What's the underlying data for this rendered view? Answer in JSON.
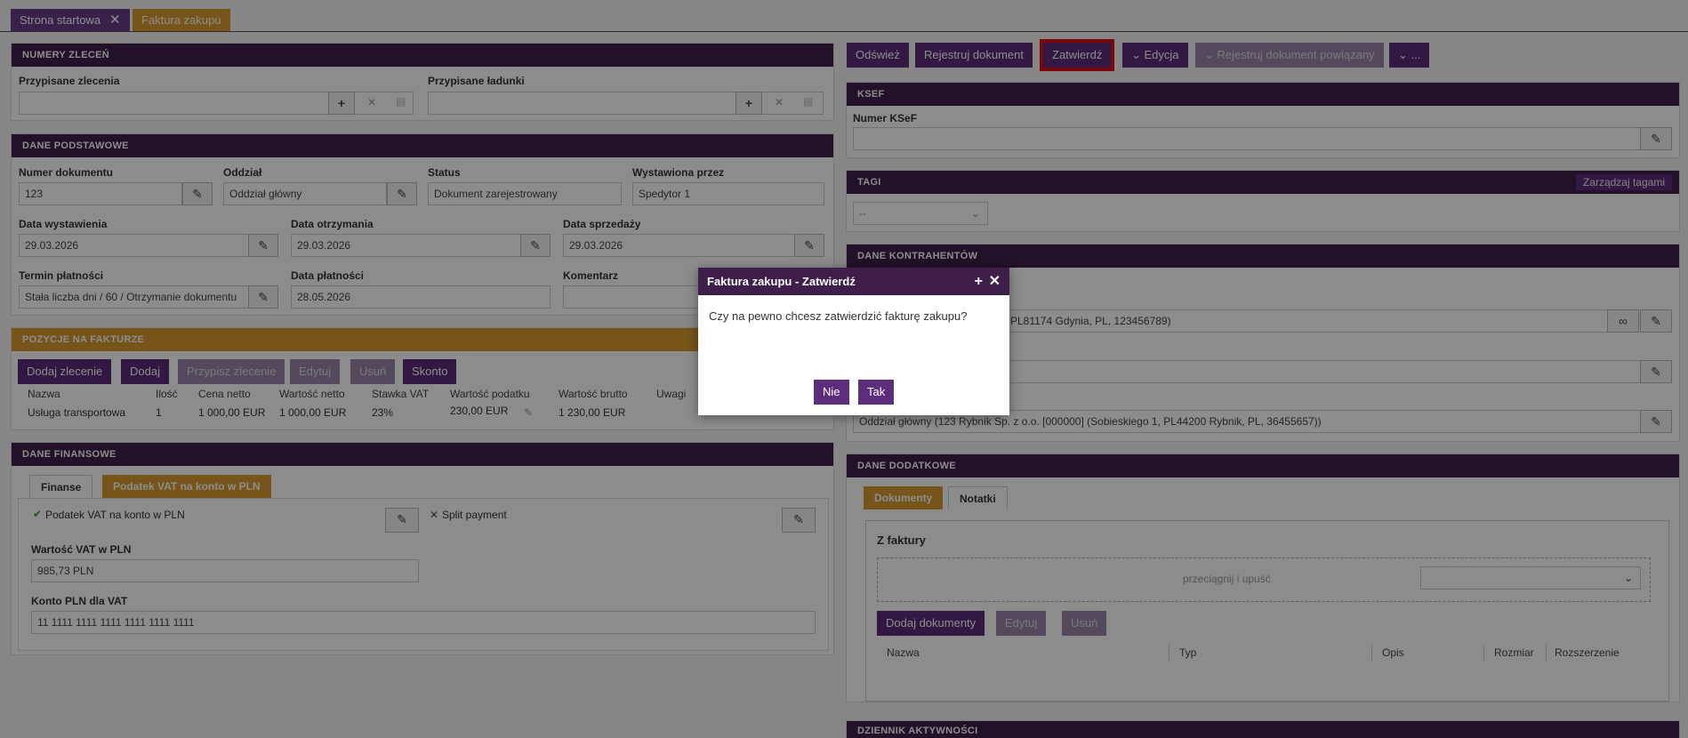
{
  "tabs": [
    {
      "label": "Strona startowa"
    },
    {
      "label": "Faktura zakupu"
    }
  ],
  "numery": {
    "title": "NUMERY ZLECEŃ",
    "assigned_orders": "Przypisane zlecenia",
    "assigned_loads": "Przypisane ładunki"
  },
  "podstawowe": {
    "title": "DANE PODSTAWOWE",
    "doc_no_label": "Numer dokumentu",
    "doc_no": "123",
    "branch_label": "Oddział",
    "branch": "Oddział główny",
    "status_label": "Status",
    "status": "Dokument zarejestrowany",
    "issued_by_label": "Wystawiona przez",
    "issued_by": "Spedytor 1",
    "issue_date_label": "Data wystawienia",
    "issue_date": "29.03.2026",
    "recv_date_label": "Data otrzymania",
    "recv_date": "29.03.2026",
    "sale_date_label": "Data sprzedaży",
    "sale_date": "29.03.2026",
    "term_label": "Termin płatności",
    "term": "Stała liczba dni / 60 / Otrzymanie dokumentu",
    "pay_date_label": "Data płatności",
    "pay_date": "28.05.2026",
    "comment_label": "Komentarz"
  },
  "pozycje": {
    "title": "POZYCJE NA FAKTURZE",
    "buttons": {
      "add_order": "Dodaj zlecenie",
      "add": "Dodaj",
      "assign_order": "Przypisz zlecenie",
      "edit": "Edytuj",
      "delete": "Usuń",
      "discount": "Skonto"
    },
    "headers": [
      "Nazwa",
      "Ilość",
      "Cena netto",
      "Wartość netto",
      "Stawka VAT",
      "Wartość podatku",
      "Wartość brutto",
      "Uwagi"
    ],
    "row": [
      "Usługa transportowa",
      "1",
      "1 000,00 EUR",
      "1 000,00 EUR",
      "23%",
      "230,00 EUR",
      "1 230,00 EUR",
      ""
    ]
  },
  "finansowe": {
    "title": "DANE FINANSOWE",
    "tab1": "Finanse",
    "tab2": "Podatek VAT na konto w PLN",
    "vat_check": "Podatek VAT na konto w PLN",
    "split": "Split payment",
    "vat_pln_label": "Wartość VAT w PLN",
    "vat_pln": "985,73 PLN",
    "account_label": "Konto PLN dla VAT",
    "account": "11 1111 1111 1111 1111 1111 1111"
  },
  "toolbar": {
    "refresh": "Odśwież",
    "register": "Rejestruj dokument",
    "approve": "Zatwierdź",
    "edit": "Edycja",
    "register_related": "Rejestruj dokument powiązany",
    "more": "..."
  },
  "ksef": {
    "title": "KSEF",
    "number_label": "Numer KSeF"
  },
  "tagi": {
    "title": "TAGI",
    "manage": "Zarządzaj tagami",
    "select": "--"
  },
  "kontrahenci": {
    "title": "DANE KONTRAHENTÓW",
    "seller_tail": "PL81174 Gdynia, PL, 123456789)",
    "buyer": "Oddział główny (123 Rybnik Sp. z o.o. [000000] (Sobieskiego 1, PL44200 Rybnik, PL, 36455657))"
  },
  "dodatkowe": {
    "title": "DANE DODATKOWE",
    "tab1": "Dokumenty",
    "tab2": "Notatki",
    "from_invoice": "Z faktury",
    "drop": "przeciągnij i upuść",
    "add_docs": "Dodaj dokumenty",
    "edit": "Edytuj",
    "delete": "Usuń",
    "headers": [
      "Nazwa",
      "Typ",
      "Opis",
      "Rozmiar",
      "Rozszerzenie"
    ]
  },
  "dziennik": {
    "title": "DZIENNIK AKTYWNOŚCI"
  },
  "modal": {
    "title": "Faktura zakupu - Zatwierdź",
    "message": "Czy na pewno chcesz zatwierdzić fakturę zakupu?",
    "no": "Nie",
    "yes": "Tak"
  }
}
